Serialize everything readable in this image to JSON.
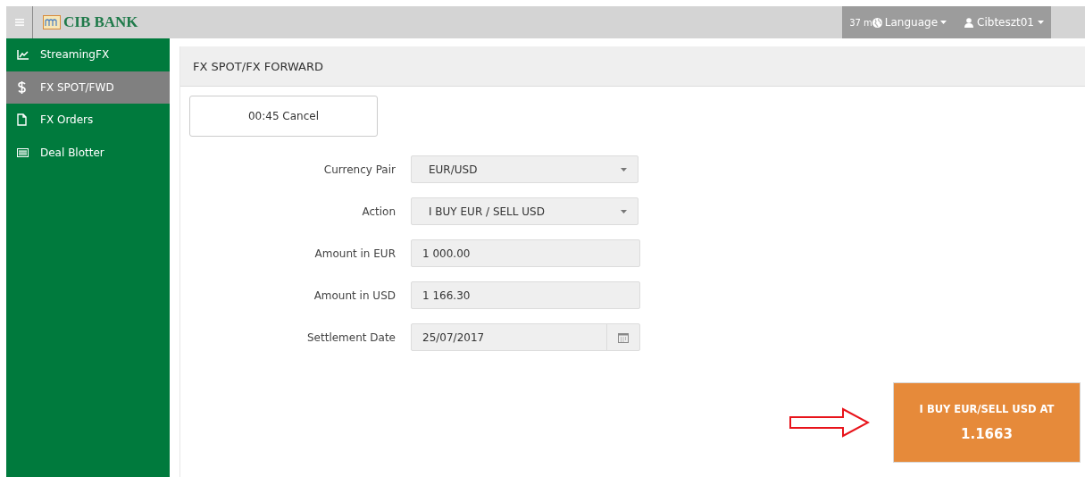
{
  "topbar": {
    "brand": "CIB BANK",
    "session": "37 m",
    "language": "Language",
    "user": "Cibteszt01"
  },
  "sidebar": {
    "items": [
      {
        "label": "StreamingFX",
        "kind": "chart",
        "selected": false
      },
      {
        "label": "FX SPOT/FWD",
        "kind": "dollar",
        "selected": true
      },
      {
        "label": "FX Orders",
        "kind": "file",
        "selected": false
      },
      {
        "label": "Deal Blotter",
        "kind": "list",
        "selected": false
      }
    ]
  },
  "panel": {
    "title": "FX SPOT/FX FORWARD",
    "cancel_button": "00:45 Cancel",
    "fields": [
      {
        "label": "Currency Pair",
        "kind": "select",
        "value": "EUR/USD"
      },
      {
        "label": "Action",
        "kind": "select",
        "value": "I BUY EUR / SELL USD"
      },
      {
        "label": "Amount in EUR",
        "kind": "input",
        "value": "1 000.00"
      },
      {
        "label": "Amount in USD",
        "kind": "input",
        "value": "1 166.30"
      },
      {
        "label": "Settlement Date",
        "kind": "date",
        "value": "25/07/2017"
      }
    ],
    "deal_button": {
      "caption": "I BUY EUR/SELL USD AT",
      "rate": "1.1663"
    }
  }
}
